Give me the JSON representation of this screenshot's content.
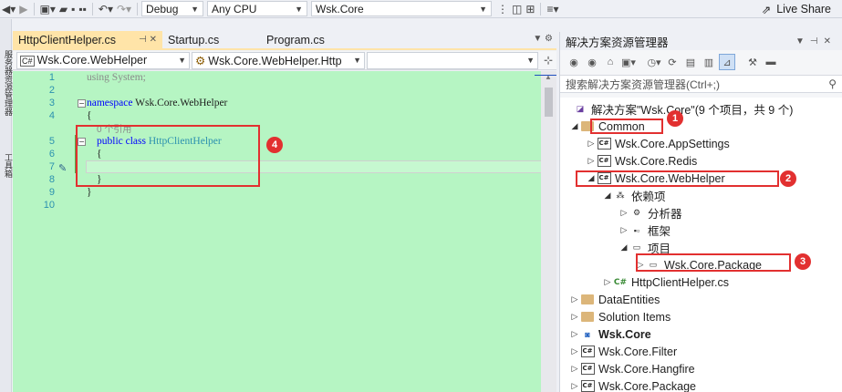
{
  "toolbar": {
    "config": "Debug",
    "platform": "Any CPU",
    "startup_project": "Wsk.Core",
    "live_share": "Live Share"
  },
  "left_strip": {
    "top_label": "服务器资源管理器",
    "bottom_label": "工具箱"
  },
  "editor": {
    "tabs": [
      {
        "label": "HttpClientHelper.cs",
        "active": true
      },
      {
        "label": "Startup.cs",
        "active": false
      },
      {
        "label": "Program.cs",
        "active": false
      }
    ],
    "nav": {
      "project": "Wsk.Core.WebHelper",
      "type": "Wsk.Core.WebHelper.Http",
      "member": ""
    },
    "line_numbers": [
      "1",
      "2",
      "3",
      "4",
      "5",
      "6",
      "7",
      "8",
      "9",
      "10"
    ],
    "code": {
      "l1": "using System;",
      "l3_kw": "namespace",
      "l3_name": " Wsk.Core.WebHelper",
      "l4": "{",
      "codelens": "0 个引用",
      "l5_kw": "public class",
      "l5_name": " HttpClientHelper",
      "l6": "{",
      "l8": "}",
      "l9": "}"
    },
    "annotation_label": "4"
  },
  "solution_explorer": {
    "title": "解决方案资源管理器",
    "search_placeholder": "搜索解决方案资源管理器(Ctrl+;)",
    "tree": [
      {
        "label": "解决方案\"Wsk.Core\"(9 个项目，共 9 个)",
        "icon": "solution-icon",
        "expander": ""
      },
      {
        "label": "Common",
        "icon": "folder-icon",
        "expander": "◢"
      },
      {
        "label": "Wsk.Core.AppSettings",
        "icon": "csproj-icon",
        "expander": "▷"
      },
      {
        "label": "Wsk.Core.Redis",
        "icon": "csproj-icon",
        "expander": "▷"
      },
      {
        "label": "Wsk.Core.WebHelper",
        "icon": "csproj-icon",
        "expander": "◢"
      },
      {
        "label": "依赖项",
        "icon": "dependencies-icon",
        "expander": "◢"
      },
      {
        "label": "分析器",
        "icon": "analyzer-icon",
        "expander": "▷"
      },
      {
        "label": "框架",
        "icon": "framework-icon",
        "expander": "▷"
      },
      {
        "label": "项目",
        "icon": "project-ref-icon",
        "expander": "◢"
      },
      {
        "label": "Wsk.Core.Package",
        "icon": "project-ref-icon",
        "expander": "▷"
      },
      {
        "label": "HttpClientHelper.cs",
        "icon": "csharp-file-icon",
        "expander": "▷"
      },
      {
        "label": "DataEntities",
        "icon": "folder-icon",
        "expander": "▷"
      },
      {
        "label": "Solution Items",
        "icon": "folder-icon",
        "expander": "▷"
      },
      {
        "label": "Wsk.Core",
        "icon": "web-project-icon",
        "expander": "▷"
      },
      {
        "label": "Wsk.Core.Filter",
        "icon": "csproj-icon",
        "expander": "▷"
      },
      {
        "label": "Wsk.Core.Hangfire",
        "icon": "csproj-icon",
        "expander": "▷"
      },
      {
        "label": "Wsk.Core.Package",
        "icon": "csproj-icon",
        "expander": "▷"
      }
    ],
    "annotations": [
      "1",
      "2",
      "3"
    ]
  },
  "colors": {
    "editor_bg": "#b6f5c3",
    "active_tab": "#ffe4a8",
    "annotation_red": "#e23030",
    "keyword_blue": "#0000ff",
    "type_teal": "#2b91af"
  }
}
